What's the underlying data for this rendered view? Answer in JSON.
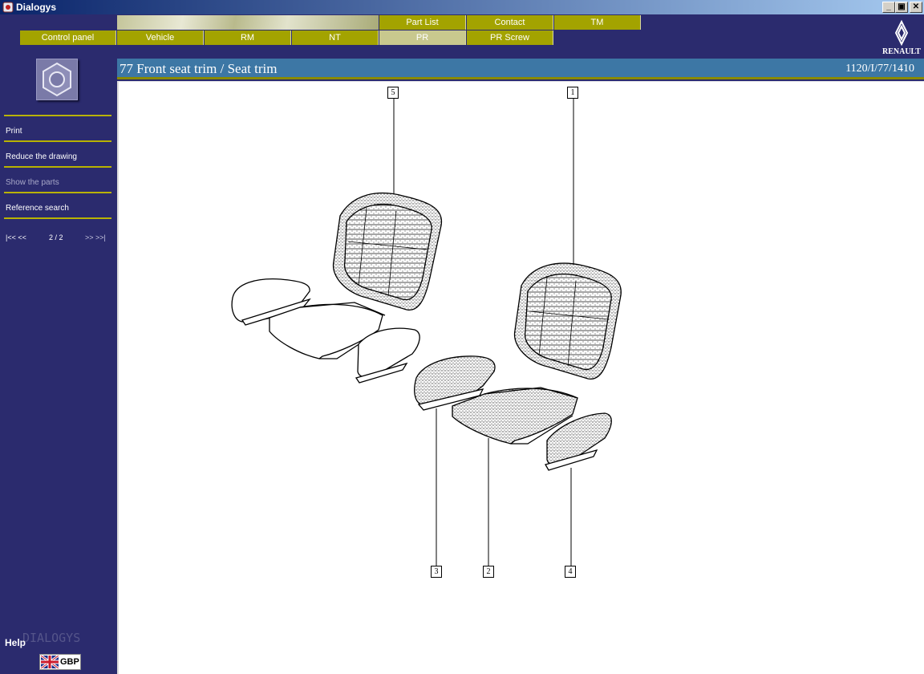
{
  "window": {
    "title": "Dialogys"
  },
  "nav": {
    "top_tabs": [
      {
        "label": "Part List",
        "active": false
      },
      {
        "label": "Contact",
        "active": false
      },
      {
        "label": "TM",
        "active": false
      }
    ],
    "main_tabs": [
      {
        "label": "Control panel",
        "active": false
      },
      {
        "label": "Vehicle",
        "active": false
      },
      {
        "label": "RM",
        "active": false
      },
      {
        "label": "NT",
        "active": false
      },
      {
        "label": "PR",
        "active": true
      },
      {
        "label": "PR Screw",
        "active": false
      }
    ],
    "brand": "RENAULT"
  },
  "sidebar": {
    "items": [
      {
        "label": "Print",
        "enabled": true
      },
      {
        "label": "Reduce the drawing",
        "enabled": true
      },
      {
        "label": "Show the parts",
        "enabled": false
      },
      {
        "label": "Reference search",
        "enabled": true
      }
    ],
    "pager": {
      "first_prev": "|<< <<",
      "page": "2 / 2",
      "next_last": ">> >>|"
    },
    "help_label": "Help",
    "footer_brand": "DIALOGYS",
    "language_code": "GBP"
  },
  "document": {
    "title": "77 Front seat trim / Seat trim",
    "reference": "1120/I/77/1410"
  },
  "drawing": {
    "callouts": [
      "5",
      "1",
      "3",
      "2",
      "4"
    ]
  },
  "colors": {
    "background": "#2b2b6e",
    "tab": "#a3a300",
    "tab_active": "#c8c88e",
    "title_bar": "#3d77a5",
    "separator": "#b8b200"
  }
}
